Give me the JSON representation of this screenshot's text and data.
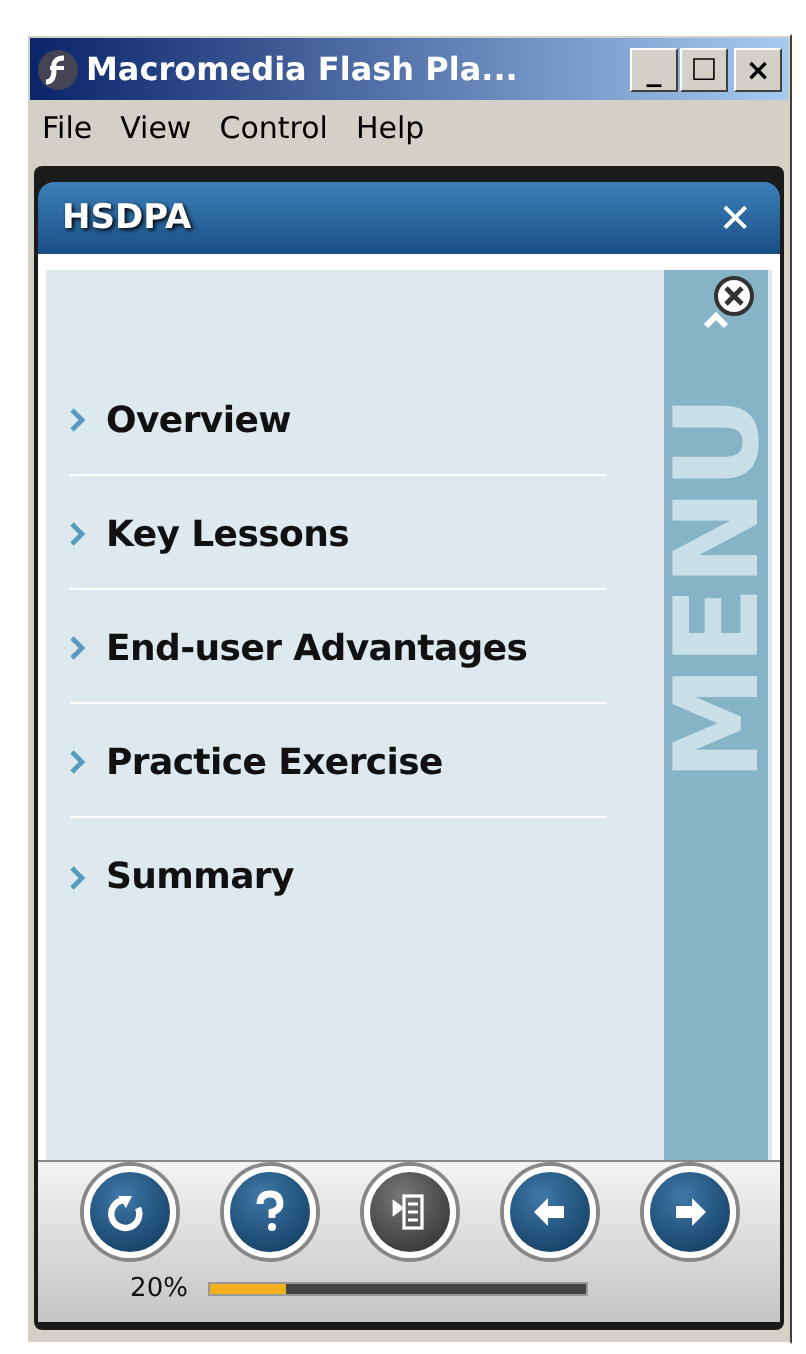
{
  "window": {
    "title": "Macromedia Flash Pla...",
    "controls": [
      "_",
      "☐",
      "×"
    ]
  },
  "menu_bar": [
    "File",
    "View",
    "Control",
    "Help"
  ],
  "panel": {
    "title": "HSDPA",
    "close": "✕"
  },
  "menu": {
    "tab_label": "MENU",
    "items": [
      {
        "label": "Overview"
      },
      {
        "label": "Key Lessons"
      },
      {
        "label": "End-user Advantages"
      },
      {
        "label": "Practice Exercise"
      },
      {
        "label": "Summary"
      }
    ]
  },
  "toolbar": {
    "buttons": [
      {
        "kind": "replay",
        "active": false
      },
      {
        "kind": "help",
        "active": false
      },
      {
        "kind": "menu",
        "active": true
      },
      {
        "kind": "back",
        "active": false
      },
      {
        "kind": "forward",
        "active": false
      }
    ],
    "progress": {
      "reading": "20%",
      "level": 0.2
    }
  }
}
